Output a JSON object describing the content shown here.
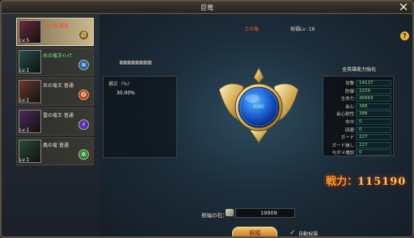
{
  "window": {
    "title": "巨竜",
    "close_glyph": "✕",
    "help_glyph": "?"
  },
  "dragons": [
    {
      "name": "土の竜 覇竜",
      "level": "Lv.5",
      "glyph": "Ǿ",
      "name_color": "#ff4b3a",
      "portrait": "#6a2a3a",
      "elem_color": "#8a5a1a"
    },
    {
      "name": "水の竜王ｲﾚｲﾅ",
      "level": "Lv.1",
      "glyph": "≋",
      "name_color": "#7ef08a",
      "portrait": "#1f4f4e",
      "elem_color": "#1a62b8"
    },
    {
      "name": "炎の竜王 普通",
      "level": "Lv.1",
      "glyph": "❂",
      "name_color": "#e8e0cc",
      "portrait": "#6a3a2a",
      "elem_color": "#c43a10"
    },
    {
      "name": "雷の竜王 普通",
      "level": "Lv.1",
      "glyph": "⚡",
      "name_color": "#e8e0cc",
      "portrait": "#4a2a5a",
      "elem_color": "#5a2ab8"
    },
    {
      "name": "風の竜 普通",
      "level": "Lv.1",
      "glyph": "✲",
      "name_color": "#e8e0cc",
      "portrait": "#2a4a3a",
      "elem_color": "#1f8a3a"
    }
  ],
  "header": {
    "element_name": "土の竜",
    "bless_level": "祝福Lv :16"
  },
  "bonus": {
    "label": "補正（%）",
    "value": "30.00%"
  },
  "orb": {
    "progress_text": "0/80"
  },
  "stats": {
    "title": "全英雄能力強化",
    "rows": [
      {
        "k": "攻撃",
        "v": "14137"
      },
      {
        "k": "防御",
        "v": "2229"
      },
      {
        "k": "生命力",
        "v": "40993"
      },
      {
        "k": "会心",
        "v": "388"
      },
      {
        "k": "会心耐性",
        "v": "388"
      },
      {
        "k": "命中",
        "v": "0"
      },
      {
        "k": "回避",
        "v": "0"
      },
      {
        "k": "ガード",
        "v": "227"
      },
      {
        "k": "ガード崩し",
        "v": "227"
      },
      {
        "k": "与ダメ増加",
        "v": "0"
      }
    ]
  },
  "power": {
    "label": "戦力：",
    "value": "115190"
  },
  "stone": {
    "label": "祝福の石：",
    "count": "19909"
  },
  "actions": {
    "bless_label": "祝福",
    "auto_label": "自動祝福",
    "auto_checked": "✓"
  },
  "colors": {
    "accent_gold": "#e6c77a",
    "stat_green": "#8be08b",
    "power_orange": "#ff9a2e"
  }
}
